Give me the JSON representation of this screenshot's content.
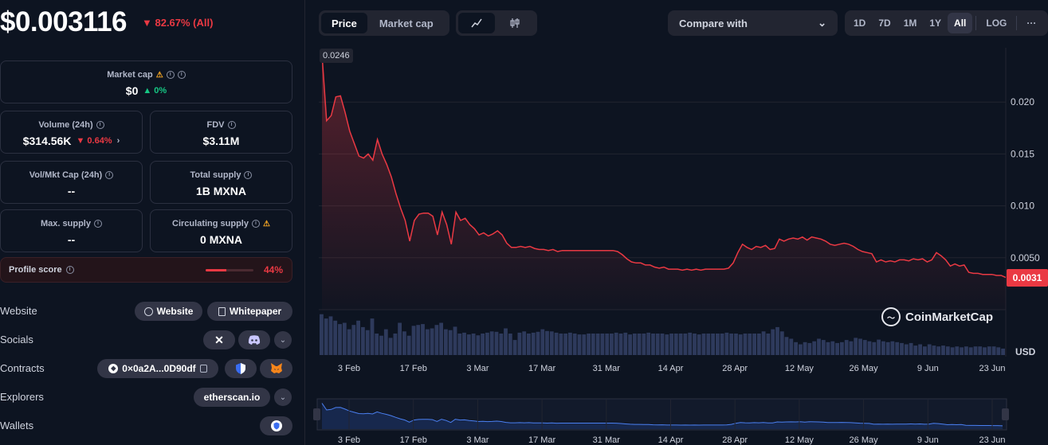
{
  "header": {
    "price": "$0.003116",
    "change": "▼ 82.67% (All)"
  },
  "stats": {
    "market_cap": {
      "label": "Market cap",
      "value": "$0",
      "change": "▲ 0%"
    },
    "volume": {
      "label": "Volume (24h)",
      "value": "$314.56K",
      "change": "▼ 0.64%"
    },
    "fdv": {
      "label": "FDV",
      "value": "$3.11M"
    },
    "vol_mkt_cap": {
      "label": "Vol/Mkt Cap (24h)",
      "value": "--"
    },
    "total_supply": {
      "label": "Total supply",
      "value": "1B MXNA"
    },
    "max_supply": {
      "label": "Max. supply",
      "value": "--"
    },
    "circulating_supply": {
      "label": "Circulating supply",
      "value": "0 MXNA"
    }
  },
  "profile": {
    "label": "Profile score",
    "value": "44%",
    "fraction": 0.44
  },
  "links": {
    "website_label": "Website",
    "website_btn": "Website",
    "whitepaper_btn": "Whitepaper",
    "socials_label": "Socials",
    "contracts_label": "Contracts",
    "contract_address": "0×0a2A...0D90df",
    "explorers_label": "Explorers",
    "explorer_btn": "etherscan.io",
    "wallets_label": "Wallets"
  },
  "toolbar": {
    "tab_price": "Price",
    "tab_market_cap": "Market cap",
    "compare": "Compare with",
    "ranges": [
      "1D",
      "7D",
      "1M",
      "1Y",
      "All"
    ],
    "log": "LOG",
    "more": "···"
  },
  "chart_data": {
    "type": "line",
    "y_ticks": [
      "0.020",
      "0.015",
      "0.010",
      "0.0050"
    ],
    "y_tick_values": [
      0.02,
      0.015,
      0.01,
      0.005
    ],
    "ylim": [
      0,
      0.025
    ],
    "x_ticks": [
      "3 Feb",
      "17 Feb",
      "3 Mar",
      "17 Mar",
      "31 Mar",
      "14 Apr",
      "28 Apr",
      "12 May",
      "26 May",
      "9 Jun",
      "23 Jun"
    ],
    "high_label": "0.0246",
    "current_label": "0.0031",
    "currency": "USD",
    "watermark": "CoinMarketCap",
    "series": [
      {
        "values": [
          0.0246,
          0.0182,
          0.0187,
          0.0205,
          0.0206,
          0.019,
          0.0172,
          0.016,
          0.0148,
          0.0146,
          0.015,
          0.0144,
          0.0164,
          0.015,
          0.014,
          0.0128,
          0.0112,
          0.0098,
          0.0086,
          0.0066,
          0.0086,
          0.0092,
          0.0093,
          0.0093,
          0.009,
          0.0072,
          0.0094,
          0.0082,
          0.0063,
          0.0094,
          0.0086,
          0.0088,
          0.0082,
          0.0078,
          0.0072,
          0.0074,
          0.0071,
          0.0073,
          0.0076,
          0.0072,
          0.0064,
          0.006,
          0.006,
          0.0061,
          0.006,
          0.0061,
          0.0059,
          0.0058,
          0.0058,
          0.0057,
          0.0058,
          0.0056,
          0.0057,
          0.0057,
          0.0057,
          0.0057,
          0.0057,
          0.0057,
          0.0057,
          0.0057,
          0.0057,
          0.0057,
          0.0057,
          0.0057,
          0.0056,
          0.0053,
          0.0049,
          0.0046,
          0.0045,
          0.0045,
          0.0043,
          0.0043,
          0.0041,
          0.004,
          0.0041,
          0.0039,
          0.0039,
          0.0039,
          0.0038,
          0.0039,
          0.0038,
          0.0039,
          0.0038,
          0.0039,
          0.0039,
          0.0039,
          0.0039,
          0.0039,
          0.004,
          0.0045,
          0.0055,
          0.0063,
          0.006,
          0.0058,
          0.0061,
          0.006,
          0.0062,
          0.0058,
          0.0059,
          0.0068,
          0.0066,
          0.0068,
          0.0069,
          0.0068,
          0.007,
          0.0067,
          0.007,
          0.0069,
          0.0068,
          0.0066,
          0.0063,
          0.0062,
          0.0063,
          0.0064,
          0.0063,
          0.0061,
          0.0058,
          0.0056,
          0.0055,
          0.0054,
          0.0046,
          0.0048,
          0.0046,
          0.0047,
          0.0046,
          0.0048,
          0.0048,
          0.0047,
          0.0049,
          0.0048,
          0.0049,
          0.0046,
          0.0048,
          0.0055,
          0.0052,
          0.0048,
          0.0042,
          0.0044,
          0.0042,
          0.0043,
          0.0036,
          0.0035,
          0.0035,
          0.0034,
          0.0034,
          0.0034,
          0.0033,
          0.0033,
          0.0031
        ]
      }
    ],
    "volume": [
      0.95,
      0.85,
      0.9,
      0.8,
      0.72,
      0.75,
      0.6,
      0.7,
      0.8,
      0.65,
      0.58,
      0.85,
      0.5,
      0.45,
      0.6,
      0.4,
      0.5,
      0.75,
      0.55,
      0.45,
      0.68,
      0.7,
      0.72,
      0.6,
      0.62,
      0.7,
      0.75,
      0.6,
      0.58,
      0.66,
      0.5,
      0.52,
      0.48,
      0.5,
      0.46,
      0.5,
      0.52,
      0.55,
      0.54,
      0.5,
      0.62,
      0.5,
      0.35,
      0.52,
      0.55,
      0.5,
      0.52,
      0.54,
      0.6,
      0.56,
      0.55,
      0.52,
      0.5,
      0.5,
      0.52,
      0.5,
      0.48,
      0.48,
      0.5,
      0.5,
      0.5,
      0.5,
      0.5,
      0.5,
      0.52,
      0.5,
      0.52,
      0.48,
      0.5,
      0.5,
      0.5,
      0.52,
      0.5,
      0.5,
      0.5,
      0.48,
      0.5,
      0.5,
      0.5,
      0.5,
      0.52,
      0.5,
      0.48,
      0.5,
      0.5,
      0.5,
      0.5,
      0.5,
      0.52,
      0.5,
      0.5,
      0.48,
      0.5,
      0.5,
      0.5,
      0.5,
      0.55,
      0.5,
      0.6,
      0.65,
      0.55,
      0.42,
      0.38,
      0.3,
      0.25,
      0.3,
      0.28,
      0.32,
      0.38,
      0.35,
      0.3,
      0.32,
      0.28,
      0.3,
      0.35,
      0.32,
      0.4,
      0.38,
      0.35,
      0.32,
      0.3,
      0.36,
      0.32,
      0.3,
      0.32,
      0.3,
      0.28,
      0.25,
      0.28,
      0.22,
      0.25,
      0.2,
      0.25,
      0.22,
      0.2,
      0.22,
      0.2,
      0.18,
      0.2,
      0.18,
      0.2,
      0.18,
      0.2,
      0.2,
      0.18,
      0.2,
      0.2,
      0.18,
      0.15
    ]
  }
}
